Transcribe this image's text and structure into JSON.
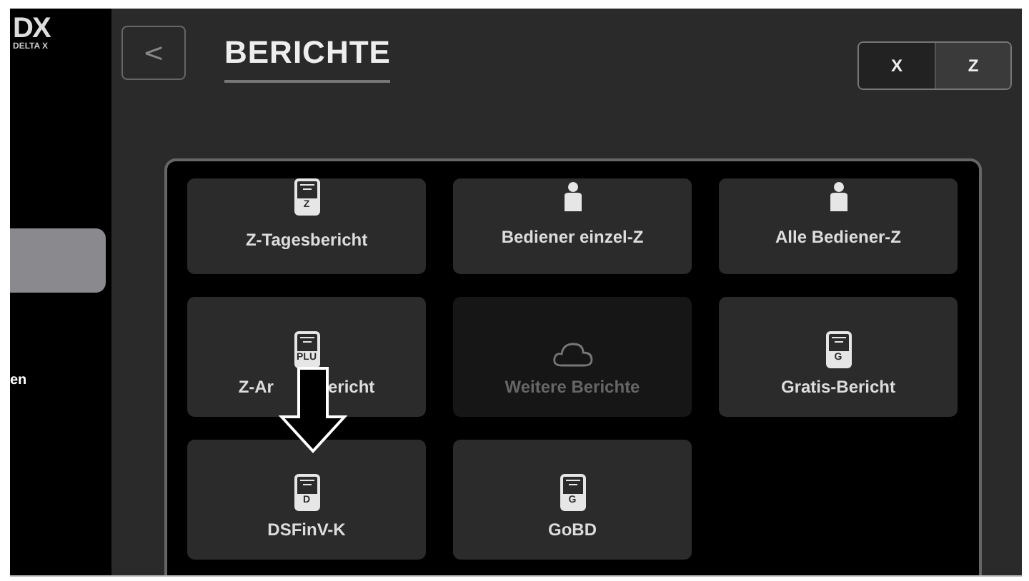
{
  "logo": {
    "mark": "DX",
    "subtitle": "DELTA X"
  },
  "sidebar": {
    "items": [
      {
        "selected": true
      },
      {
        "label": "en",
        "selected": false
      }
    ]
  },
  "header": {
    "back": "<",
    "title": "BERICHTE",
    "toggle": [
      {
        "label": "X",
        "selected": false
      },
      {
        "label": "Z",
        "selected": true
      }
    ]
  },
  "tiles": [
    {
      "label_parts": [
        "Z-Tagesbericht"
      ],
      "kind": "receipt",
      "icon_text": "Z",
      "disabled": false
    },
    {
      "label_parts": [
        "Bediener einzel-Z"
      ],
      "kind": "person",
      "disabled": false
    },
    {
      "label_parts": [
        "Alle Bediener-Z"
      ],
      "kind": "person",
      "disabled": false
    },
    {
      "label_parts": [
        "Z-Ar",
        "ericht"
      ],
      "kind": "receipt",
      "icon_text": "PLU",
      "disabled": false
    },
    {
      "label_parts": [
        "Weitere Berichte"
      ],
      "kind": "cloud",
      "disabled": true
    },
    {
      "label_parts": [
        "Gratis-Bericht"
      ],
      "kind": "receipt",
      "icon_text": "G",
      "disabled": false
    },
    {
      "label_parts": [
        "DSFinV-K"
      ],
      "kind": "receipt",
      "icon_text": "D",
      "disabled": false
    },
    {
      "label_parts": [
        "GoBD"
      ],
      "kind": "receipt",
      "icon_text": "G",
      "disabled": false
    }
  ]
}
